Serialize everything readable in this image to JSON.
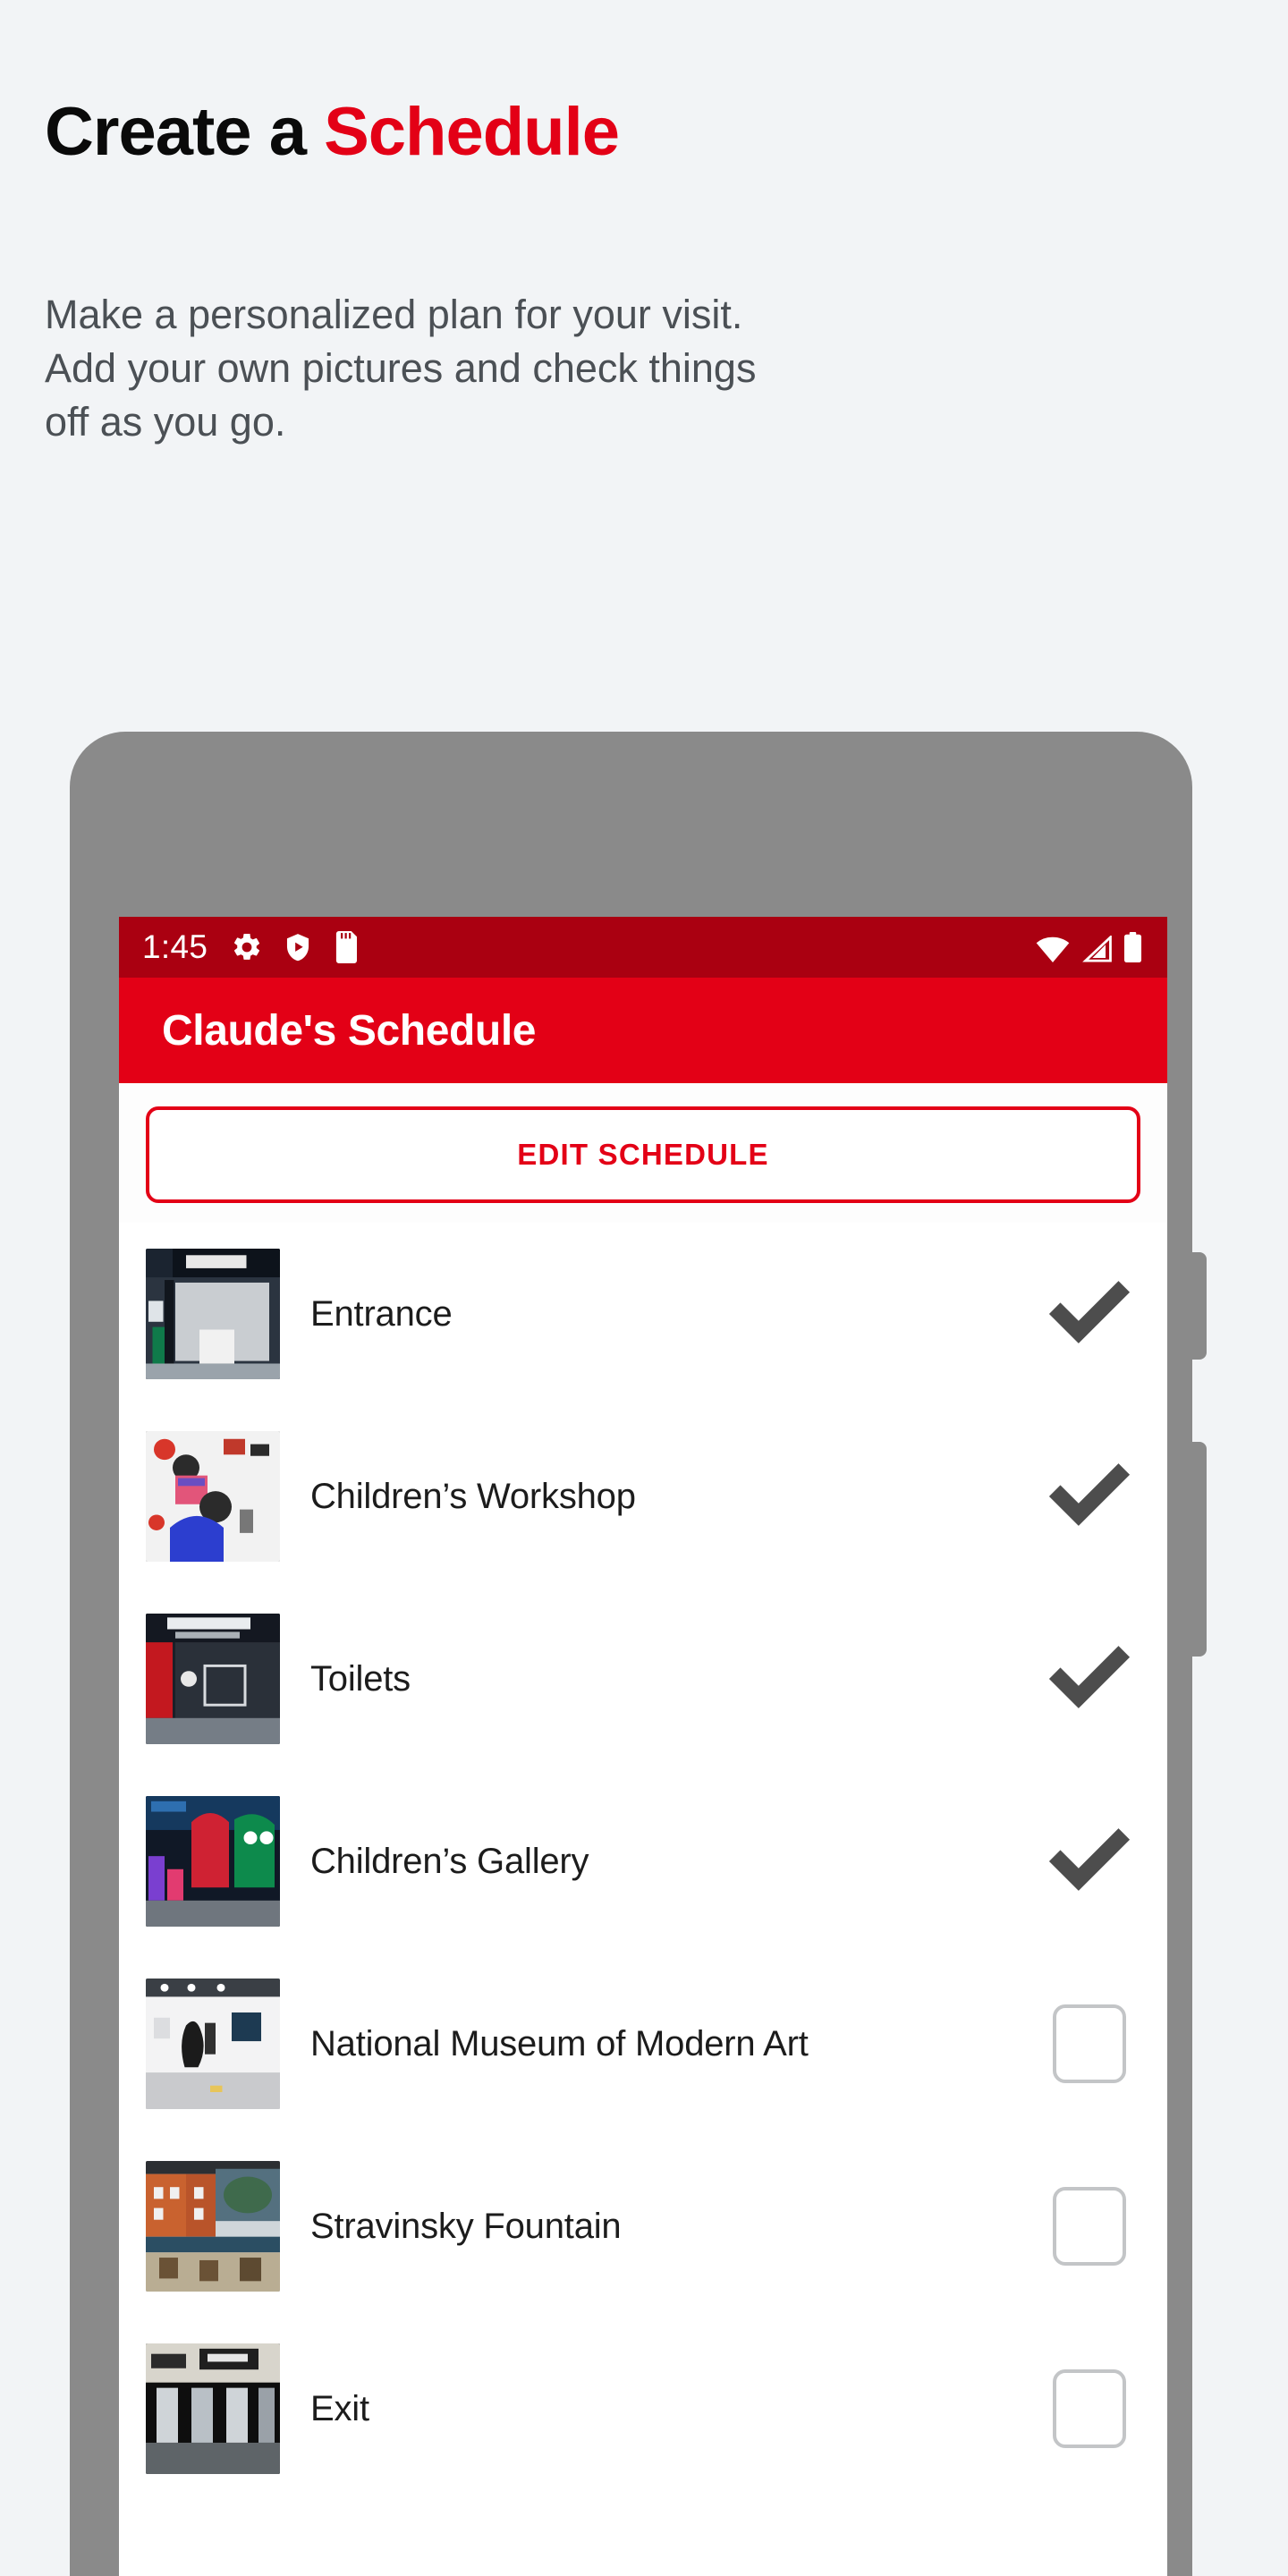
{
  "intro": {
    "headline_part1": "Create a ",
    "headline_part2": "Schedule",
    "subcopy_line1": "Make a personalized plan for your visit.",
    "subcopy_line2": "Add your own pictures and check things",
    "subcopy_line3": "off as you go.",
    "accent_color": "#E30016",
    "text_color": "#4B5055"
  },
  "phone": {
    "frame_color": "#8A8A8A",
    "buttons": [
      "power-button",
      "volume-button"
    ]
  },
  "statusbar": {
    "time": "1:45",
    "background_color": "#AA0011",
    "left_icons": [
      "gear-icon",
      "shield-play-icon",
      "sd-card-icon"
    ],
    "right_icons": [
      "wifi-icon",
      "cell-signal-icon",
      "battery-icon"
    ]
  },
  "appbar": {
    "title": "Claude's Schedule",
    "background_color": "#E30016"
  },
  "actions": {
    "edit_schedule_label": "EDIT SCHEDULE"
  },
  "schedule": {
    "items": [
      {
        "label": "Entrance",
        "checked": true,
        "thumb": "entrance-thumbnail"
      },
      {
        "label": "Children’s Workshop",
        "checked": true,
        "thumb": "childrens-workshop-thumbnail"
      },
      {
        "label": "Toilets",
        "checked": true,
        "thumb": "toilets-thumbnail"
      },
      {
        "label": "Children’s Gallery",
        "checked": true,
        "thumb": "childrens-gallery-thumbnail"
      },
      {
        "label": "National Museum of Modern Art",
        "checked": false,
        "thumb": "modern-art-museum-thumbnail"
      },
      {
        "label": "Stravinsky Fountain",
        "checked": false,
        "thumb": "stravinsky-fountain-thumbnail"
      },
      {
        "label": "Exit",
        "checked": false,
        "thumb": "exit-thumbnail"
      }
    ],
    "check_color": "#4D4D4D",
    "checkbox_border_color": "#C3C5C7"
  }
}
